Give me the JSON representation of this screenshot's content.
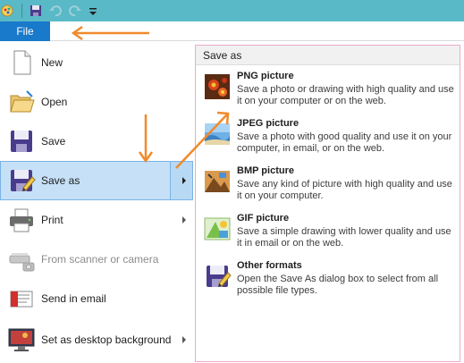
{
  "quick_access": {
    "items": [
      "paint-app-icon",
      "save-icon",
      "undo-icon",
      "redo-icon",
      "customize-qat-icon"
    ]
  },
  "ribbon": {
    "file_tab": "File"
  },
  "menu": {
    "items": [
      {
        "label": "New",
        "icon": "new-document-icon"
      },
      {
        "label": "Open",
        "icon": "open-folder-icon"
      },
      {
        "label": "Save",
        "icon": "save-disk-icon"
      },
      {
        "label": "Save as",
        "icon": "save-as-icon",
        "selected": true
      },
      {
        "label": "Print",
        "icon": "printer-icon"
      },
      {
        "label": "From scanner or camera",
        "icon": "scanner-icon",
        "disabled": true
      },
      {
        "label": "Send in email",
        "icon": "email-icon"
      },
      {
        "label": "Set as desktop background",
        "icon": "desktop-background-icon"
      }
    ]
  },
  "panel": {
    "header": "Save as",
    "options": [
      {
        "title": "PNG picture",
        "desc": "Save a photo or drawing with high quality and use it on your computer or on the web.",
        "icon": "png-picture-icon"
      },
      {
        "title": "JPEG picture",
        "desc": "Save a photo with good quality and use it on your computer, in email, or on the web.",
        "icon": "jpeg-picture-icon"
      },
      {
        "title": "BMP picture",
        "desc": "Save any kind of picture with high quality and use it on your computer.",
        "icon": "bmp-picture-icon"
      },
      {
        "title": "GIF picture",
        "desc": "Save a simple drawing with lower quality and use it in email or on the web.",
        "icon": "gif-picture-icon"
      },
      {
        "title": "Other formats",
        "desc": "Open the Save As dialog box to select from all possible file types.",
        "icon": "other-formats-icon"
      }
    ]
  },
  "colors": {
    "title_bar": "#59b9c6",
    "file_tab": "#1979ca",
    "selected_item": "#c5e0f7",
    "annotation_arrow": "#f08a2c",
    "panel_border": "#f0a9cc"
  }
}
